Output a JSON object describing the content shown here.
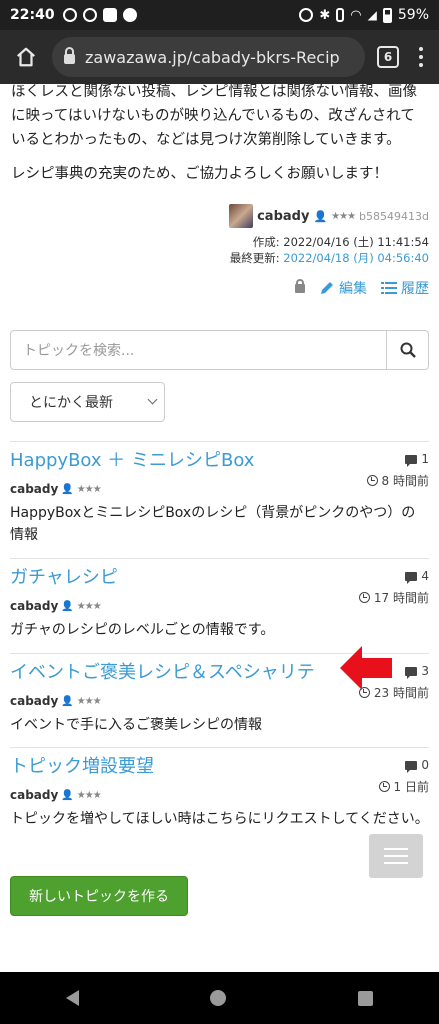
{
  "status_bar": {
    "time": "22:40",
    "battery": "59%",
    "left_icons": [
      "call-icon",
      "alarm-icon",
      "notification-icon",
      "circle-app-icon"
    ],
    "right_icons": [
      "alarm-icon",
      "bluetooth-icon",
      "vibrate-icon",
      "wifi-icon",
      "signal-icon",
      "battery-icon"
    ]
  },
  "browser": {
    "url": "zawazawa.jp/cabady-bkrs-Recip",
    "tab_count": "6"
  },
  "intro": {
    "paragraph1": "ほくレスと関係ない投稿、レシピ情報とは関係ない情報、画像に映ってはいけないものが映り込んでいるもの、改ざんされているとわかったもの、などは見つけ次第削除していきます。",
    "paragraph2": "レシピ事典の充実のため、ご協力よろしくお願いします！"
  },
  "author": {
    "name": "cabady",
    "rank": "★★★",
    "uid": "b58549413d",
    "created_label": "作成: 2022/04/16 (土) 11:41:54",
    "updated_prefix": "最終更新: ",
    "updated_value": "2022/04/18 (月) 04:56:40",
    "edit_label": "編集",
    "history_label": "履歴"
  },
  "search": {
    "placeholder": "トピックを検索..."
  },
  "sort": {
    "selected": "とにかく最新"
  },
  "topics": [
    {
      "title": "HappyBox ＋ ミニレシピBox",
      "comments": "1",
      "time": "8 時間前",
      "author": "cabady",
      "rank": "★★★",
      "description": "HappyBoxとミニレシピBoxのレシピ（背景がピンクのやつ）の情報"
    },
    {
      "title": "ガチャレシピ",
      "comments": "4",
      "time": "17 時間前",
      "author": "cabady",
      "rank": "★★★",
      "description": "ガチャのレシピのレベルごとの情報です。"
    },
    {
      "title": "イベントご褒美レシピ＆スペシャリテ",
      "comments": "3",
      "time": "23 時間前",
      "author": "cabady",
      "rank": "★★★",
      "description": "イベントで手に入るご褒美レシピの情報"
    },
    {
      "title": "トピック増設要望",
      "comments": "0",
      "time": "1 日前",
      "author": "cabady",
      "rank": "★★★",
      "description": "トピックを増やしてほしい時はこちらにリクエストしてください。"
    }
  ],
  "new_topic_button": "新しいトピックを作る",
  "colors": {
    "link": "#3a9bd5",
    "button_green": "#4ea12e",
    "annotation_red": "#e8101a"
  }
}
